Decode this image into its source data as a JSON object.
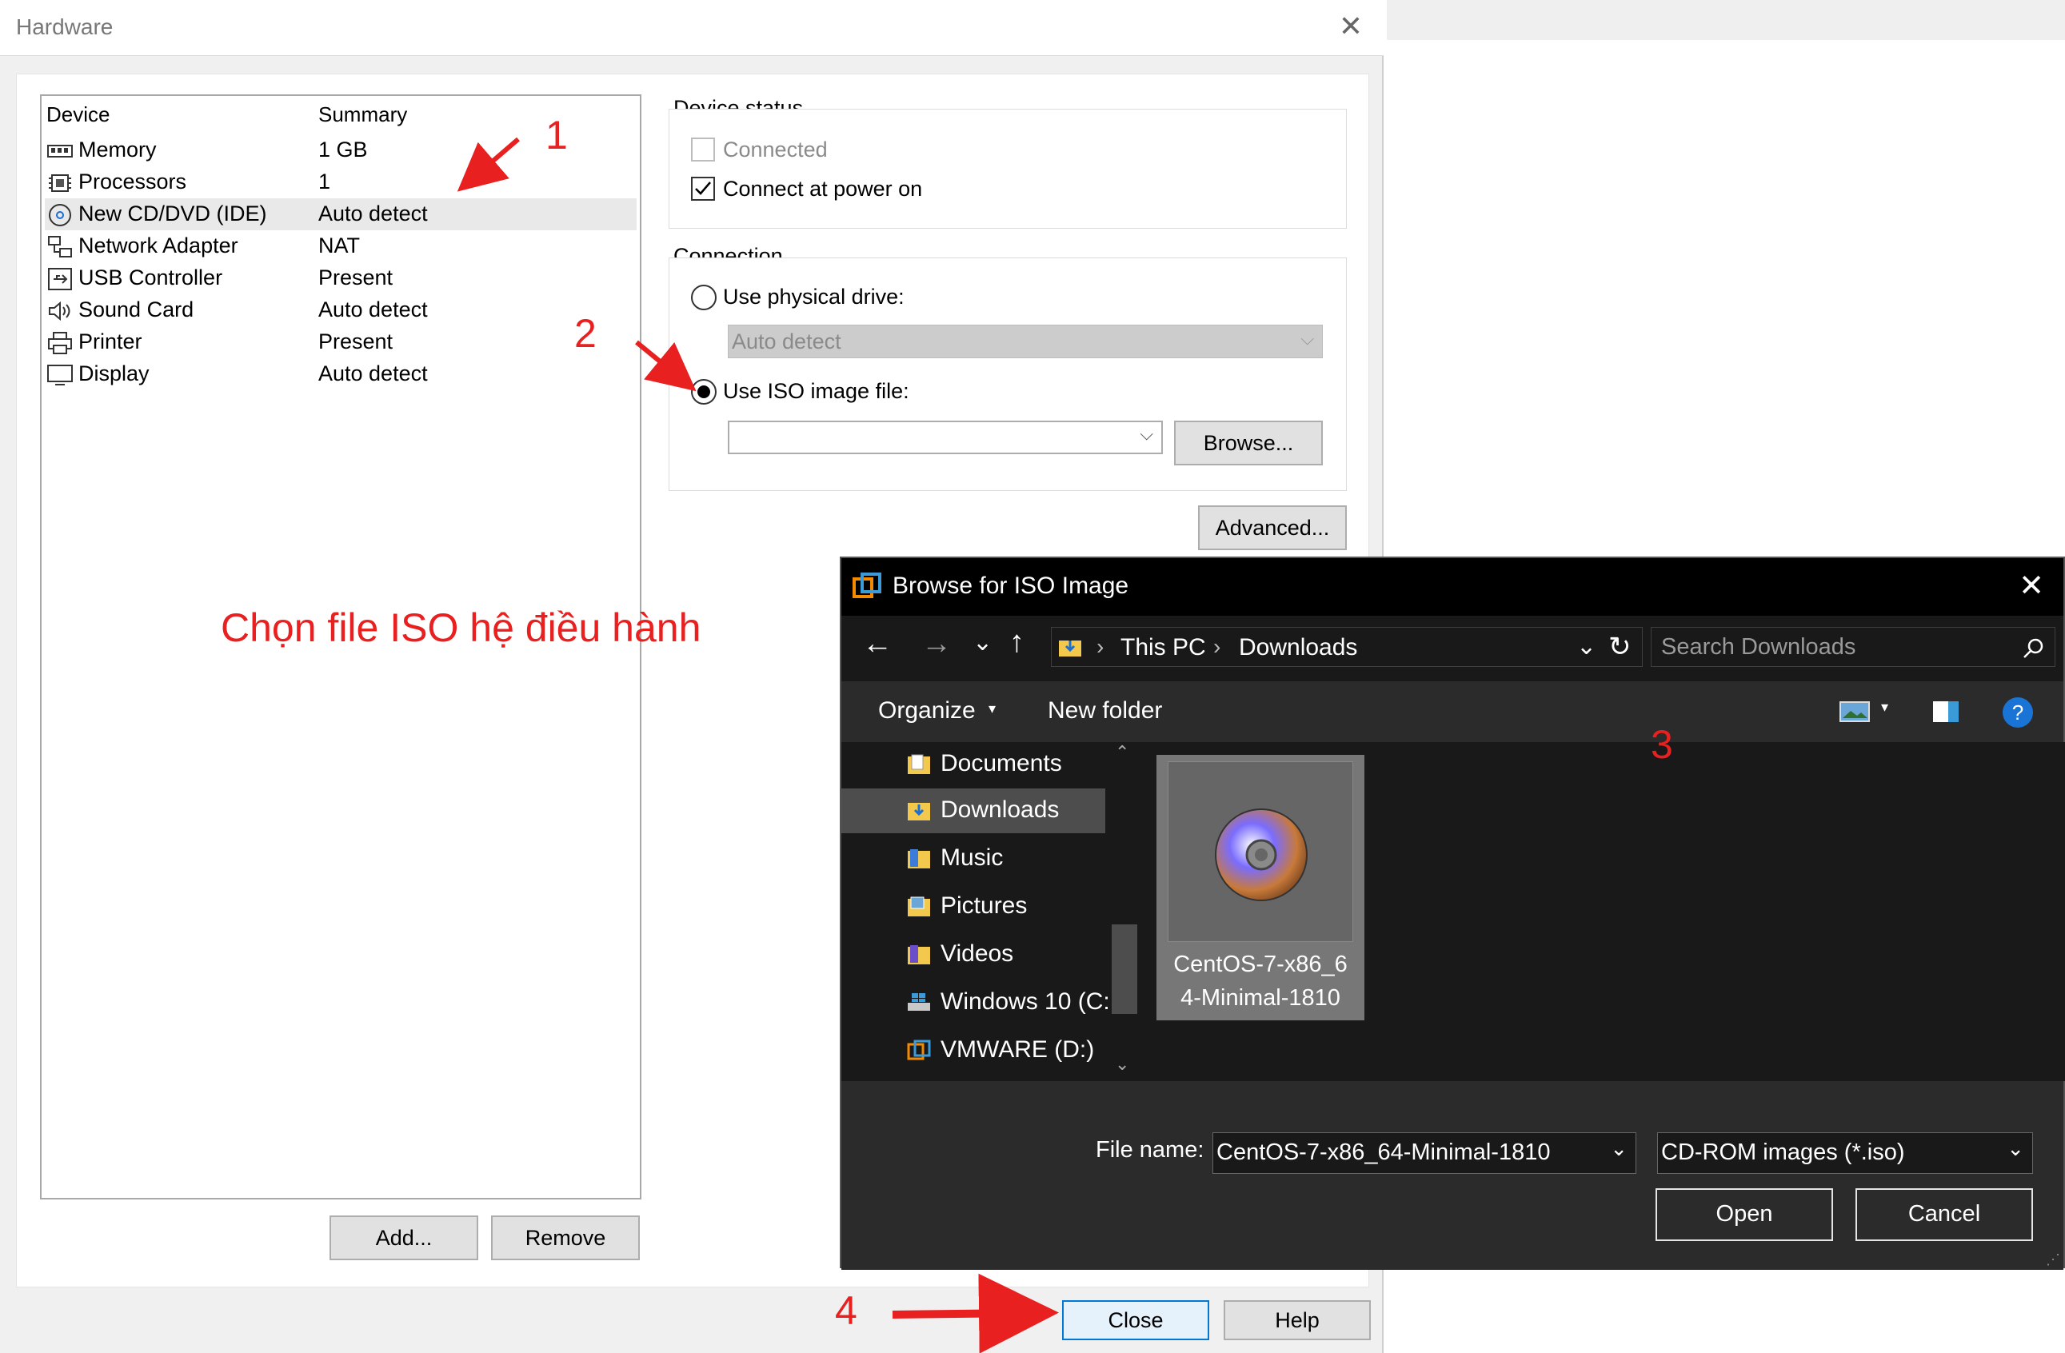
{
  "hardware": {
    "title": "Hardware",
    "columns": {
      "device": "Device",
      "summary": "Summary"
    },
    "devices": [
      {
        "name": "Memory",
        "summary": "1 GB",
        "icon": "memory-icon"
      },
      {
        "name": "Processors",
        "summary": "1",
        "icon": "processor-icon"
      },
      {
        "name": "New CD/DVD (IDE)",
        "summary": "Auto detect",
        "icon": "cd-dvd-icon",
        "selected": true
      },
      {
        "name": "Network Adapter",
        "summary": "NAT",
        "icon": "network-adapter-icon"
      },
      {
        "name": "USB Controller",
        "summary": "Present",
        "icon": "usb-controller-icon"
      },
      {
        "name": "Sound Card",
        "summary": "Auto detect",
        "icon": "sound-card-icon"
      },
      {
        "name": "Printer",
        "summary": "Present",
        "icon": "printer-icon"
      },
      {
        "name": "Display",
        "summary": "Auto detect",
        "icon": "display-icon"
      }
    ],
    "add_label": "Add...",
    "remove_label": "Remove",
    "device_status": {
      "title": "Device status",
      "connected": "Connected",
      "connect_at_power_on": "Connect at power on"
    },
    "connection": {
      "title": "Connection",
      "use_physical_drive": "Use physical drive:",
      "physical_drive_value": "Auto detect",
      "use_iso_image": "Use ISO image file:",
      "iso_value": "",
      "browse_label": "Browse..."
    },
    "advanced_label": "Advanced...",
    "close_label": "Close",
    "help_label": "Help"
  },
  "annotations": {
    "step1": "1",
    "step2": "2",
    "step3": "3",
    "step4": "4",
    "caption": "Chọn file ISO hệ điều hành",
    "color": "#e82020"
  },
  "browse_dialog": {
    "title": "Browse for ISO Image",
    "breadcrumb": [
      "This PC",
      "Downloads"
    ],
    "search_placeholder": "Search Downloads",
    "organize_label": "Organize",
    "new_folder_label": "New folder",
    "nav_items": [
      {
        "label": "Documents",
        "icon": "documents-folder-icon"
      },
      {
        "label": "Downloads",
        "icon": "downloads-folder-icon",
        "selected": true
      },
      {
        "label": "Music",
        "icon": "music-folder-icon"
      },
      {
        "label": "Pictures",
        "icon": "pictures-folder-icon"
      },
      {
        "label": "Videos",
        "icon": "videos-folder-icon"
      },
      {
        "label": "Windows 10 (C:",
        "icon": "windows-drive-icon"
      },
      {
        "label": "VMWARE (D:)",
        "icon": "vmware-drive-icon"
      }
    ],
    "file": {
      "name_line1": "CentOS-7-x86_6",
      "name_line2": "4-Minimal-1810",
      "icon": "disc-image-icon"
    },
    "file_name_label": "File name:",
    "file_name_value": "CentOS-7-x86_64-Minimal-1810",
    "file_type_value": "CD-ROM images (*.iso)",
    "open_label": "Open",
    "cancel_label": "Cancel",
    "accent": "#0078d7"
  }
}
